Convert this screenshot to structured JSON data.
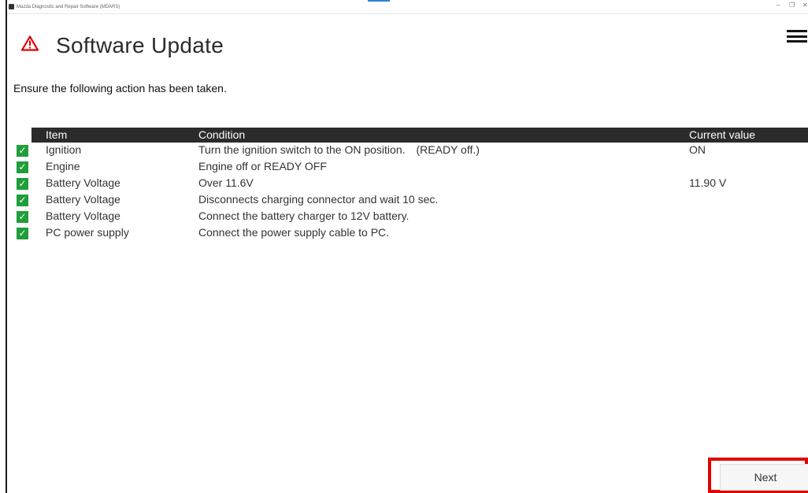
{
  "window": {
    "title": "Mazda Diagnostic and Repair Software (MDARS)",
    "minimize": "–",
    "restore": "❐",
    "close": "✕"
  },
  "header": {
    "title": "Software Update",
    "warning_icon": "warning-triangle-icon",
    "menu_icon": "hamburger-menu-icon"
  },
  "instruction": "Ensure the following action has been taken.",
  "table": {
    "columns": [
      "Item",
      "Condition",
      "Current value"
    ],
    "rows": [
      {
        "checked": true,
        "item": "Ignition",
        "condition": "Turn the ignition switch to the ON position.　(READY off.)",
        "value": "ON"
      },
      {
        "checked": true,
        "item": "Engine",
        "condition": "Engine off or READY OFF",
        "value": ""
      },
      {
        "checked": true,
        "item": "Battery Voltage",
        "condition": "Over 11.6V",
        "value": "11.90 V"
      },
      {
        "checked": true,
        "item": "Battery Voltage",
        "condition": "Disconnects charging connector and wait 10 sec.",
        "value": ""
      },
      {
        "checked": true,
        "item": "Battery Voltage",
        "condition": "Connect the battery charger to 12V battery.",
        "value": ""
      },
      {
        "checked": true,
        "item": "PC power supply",
        "condition": "Connect the power supply cable to PC.",
        "value": ""
      }
    ],
    "check_glyph": "✓"
  },
  "footer": {
    "next_label": "Next"
  },
  "colors": {
    "accent_red": "#e10000",
    "check_green": "#1f9e3a",
    "header_dark": "#2b2b2b"
  }
}
